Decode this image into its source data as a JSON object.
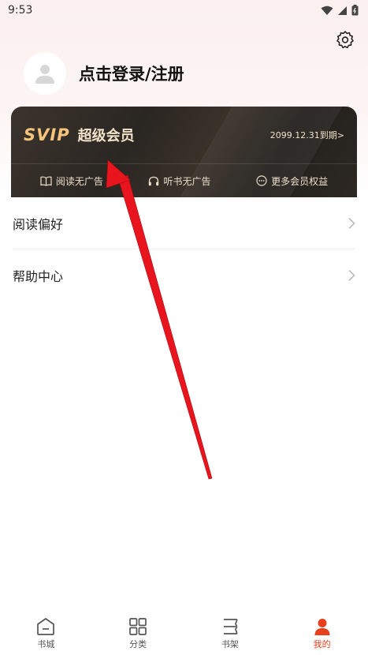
{
  "status_bar": {
    "time": "9:53"
  },
  "profile": {
    "login_label": "点击登录/注册"
  },
  "vip": {
    "badge": "SVIP",
    "title": "超级会员",
    "expire": "2099.12.31到期>",
    "benefits": [
      {
        "label": "阅读无广告",
        "icon": "book-icon"
      },
      {
        "label": "听书无广告",
        "icon": "headphones-icon"
      },
      {
        "label": "更多会员权益",
        "icon": "more-icon"
      }
    ]
  },
  "menu": [
    {
      "label": "阅读偏好"
    },
    {
      "label": "帮助中心"
    }
  ],
  "nav": [
    {
      "label": "书城",
      "icon": "home-icon"
    },
    {
      "label": "分类",
      "icon": "grid-icon"
    },
    {
      "label": "书架",
      "icon": "bookshelf-icon"
    },
    {
      "label": "我的",
      "icon": "user-icon",
      "active": true
    }
  ],
  "colors": {
    "accent": "#e8401c",
    "vip_gold": "#f4c57a",
    "arrow": "#e8141e"
  }
}
